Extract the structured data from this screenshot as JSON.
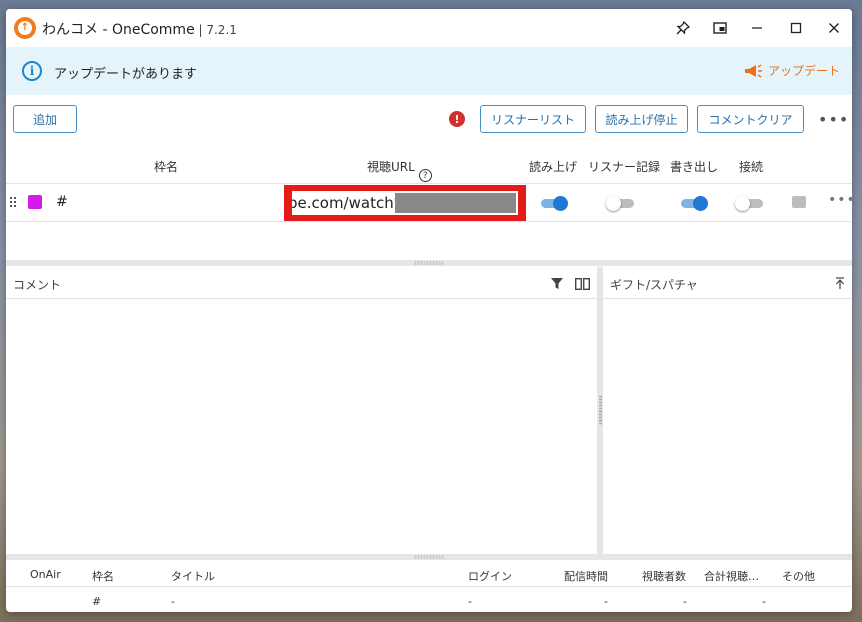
{
  "window": {
    "app_name": "わんコメ - OneComme",
    "separator": " | ",
    "version": "7.2.1"
  },
  "banner": {
    "message": "アップデートがあります",
    "update_label": "アップデート",
    "accent_color": "#e8731a"
  },
  "toolbar": {
    "add_label": "追加",
    "listener_list_label": "リスナーリスト",
    "stop_reading_label": "読み上げ停止",
    "clear_comments_label": "コメントクリア"
  },
  "frames": {
    "headers": {
      "name": "枠名",
      "url": "視聴URL",
      "read_aloud": "読み上げ",
      "listener_record": "リスナー記録",
      "export": "書き出し",
      "connect": "接続"
    },
    "rows": [
      {
        "name": "#",
        "color": "#d41ae8",
        "url": "be.com/watch?",
        "read_aloud": true,
        "listener_record": false,
        "export": true,
        "connect": false
      }
    ]
  },
  "comments_pane": {
    "title": "コメント"
  },
  "gifts_pane": {
    "title": "ギフト/スパチャ"
  },
  "info_table": {
    "headers": [
      "OnAir",
      "枠名",
      "タイトル",
      "ログイン",
      "配信時間",
      "視聴者数",
      "合計視聴…",
      "その他"
    ],
    "row": [
      "",
      "#",
      "-",
      "-",
      "-",
      "-",
      "-",
      ""
    ]
  }
}
